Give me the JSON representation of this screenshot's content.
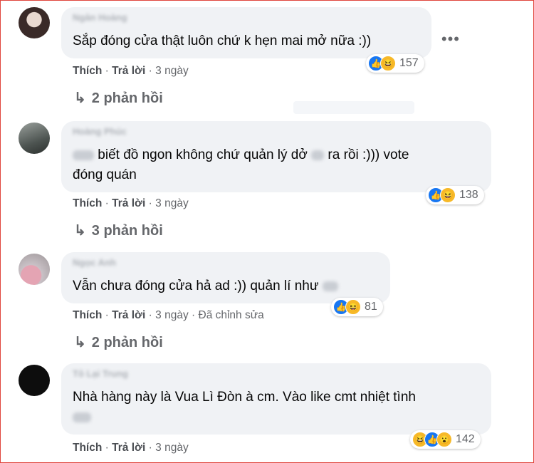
{
  "comments": [
    {
      "author": "Ngân Hoàng",
      "text": "Sắp đóng cửa thật luôn chứ k hẹn mai mở nữa :))",
      "actions": {
        "like": "Thích",
        "reply": "Trả lời",
        "time": "3 ngày"
      },
      "reaction_count": "157",
      "replies": "2 phản hồi"
    },
    {
      "author": "Hoàng Phúc",
      "text_line1": "biết đồ ngon không chứ quản lý dở",
      "text_line1_end": "ra rồi :))) vote",
      "text_line2": "đóng quán",
      "actions": {
        "like": "Thích",
        "reply": "Trả lời",
        "time": "3 ngày"
      },
      "reaction_count": "138",
      "replies": "3 phản hồi"
    },
    {
      "author": "Ngọc Anh",
      "text": "Vẫn chưa đóng cửa hả ad :)) quản lí như",
      "actions": {
        "like": "Thích",
        "reply": "Trả lời",
        "time": "3 ngày",
        "edited": "Đã chỉnh sửa"
      },
      "reaction_count": "81",
      "replies": "2 phản hồi"
    },
    {
      "author": "Tô Lại Trung",
      "text": "Nhà hàng này là Vua Lì Đòn à cm. Vào like cmt nhiệt tình",
      "actions": {
        "like": "Thích",
        "reply": "Trả lời",
        "time": "3 ngày"
      },
      "reaction_count": "142"
    }
  ],
  "ui": {
    "more_options": "•••",
    "reply_arrow": "↳",
    "separator": "·"
  },
  "colors": {
    "bubble": "#f0f2f5",
    "meta_text": "#65676b",
    "like_blue": "#1877f2",
    "haha_yellow": "#f7b928",
    "frame": "#e0463d"
  }
}
